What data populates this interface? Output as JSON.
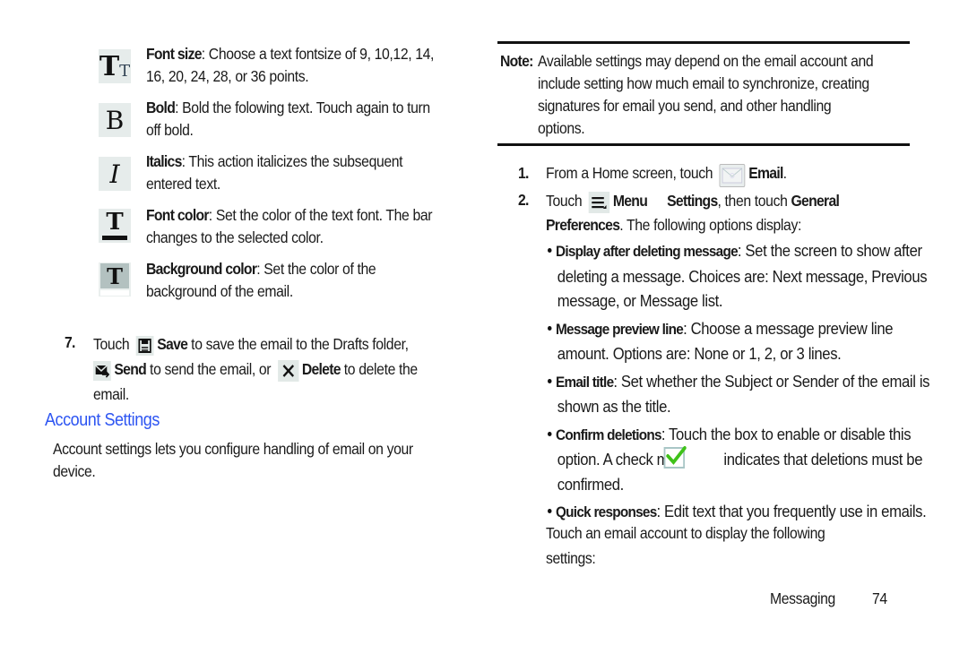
{
  "left_column": {
    "format_options": [
      {
        "icon": "font-size-icon",
        "label": "Font size",
        "text_line1": ": Choose a text fontsize of 9, 10,12, 14,",
        "text_line2": "16, 20, 24, 28, or 36 points."
      },
      {
        "icon": "bold-icon",
        "label": "Bold",
        "text_line1": ": Bold the folowing text. Touch again to turn",
        "text_line2": "off bold."
      },
      {
        "icon": "italic-icon",
        "label": "Italics",
        "text_line1": ": This action italicizes the subsequent",
        "text_line2": "entered text."
      },
      {
        "icon": "font-color-icon",
        "label": "Font color",
        "text_line1": ": Set the color of the text font. The bar",
        "text_line2": "changes to the selected color."
      },
      {
        "icon": "background-color-icon",
        "label": "Background color",
        "text_line1": ": Set the color of the",
        "text_line2": "background of the email."
      }
    ],
    "step7": {
      "number": "7.",
      "touch": "Touch",
      "save_label": "Save",
      "save_text": " to save the email to the Drafts folder,",
      "send_label": "Send",
      "send_text": " to send the email, or",
      "delete_label": "Delete",
      "delete_text": " to delete the",
      "tail": "email."
    },
    "section_heading": "Account Settings",
    "section_body_line1": "Account settings lets you configure handling of email on your",
    "section_body_line2": "device."
  },
  "right_column": {
    "note": {
      "label": "Note:",
      "lines": [
        "Available settings may depend on the email account and",
        "include setting how much email to synchronize, creating",
        "signatures for email you send, and other handling",
        "options."
      ]
    },
    "step1": {
      "number": "1.",
      "text": "From a Home screen, touch",
      "label": "Email",
      "tail": "."
    },
    "step2": {
      "number": "2.",
      "touch": "Touch",
      "menu_label": "Menu",
      "settings_label": "Settings",
      "mid_text": ", then touch",
      "general_label": "General",
      "preferences_label": "Preferences",
      "tail": ". The following options display:"
    },
    "bullets": [
      {
        "label": "Display after deleting message",
        "lines": [
          ": Set the screen to show after",
          "deleting a message. Choices are: Next message, Previous",
          "message, or Message list."
        ]
      },
      {
        "label": "Message preview line",
        "lines": [
          ": Choose a message preview line",
          "amount. Options are: None or 1, 2, or 3 lines."
        ]
      },
      {
        "label": "Email title",
        "lines": [
          ": Set whether the Subject or Sender of the email is",
          "shown as the title."
        ]
      },
      {
        "label": "Confirm deletions",
        "lines": [
          ": Touch the box to enable or disable this",
          "option. A check m",
          "indicates that deletions must be",
          "confirmed."
        ],
        "checkbox_checked": true
      },
      {
        "label": "Quick responses",
        "lines": [
          ": Edit text that you frequently use in emails."
        ]
      }
    ],
    "closing_line1": "Touch an email account to display the following",
    "closing_line2": "settings:"
  },
  "footer": {
    "section": "Messaging",
    "page_number": "74"
  },
  "colors": {
    "heading": "#2d55f2",
    "text": "#1a1a1a",
    "icon_bg": "#e6eceb",
    "check_green": "#3fc21a"
  }
}
